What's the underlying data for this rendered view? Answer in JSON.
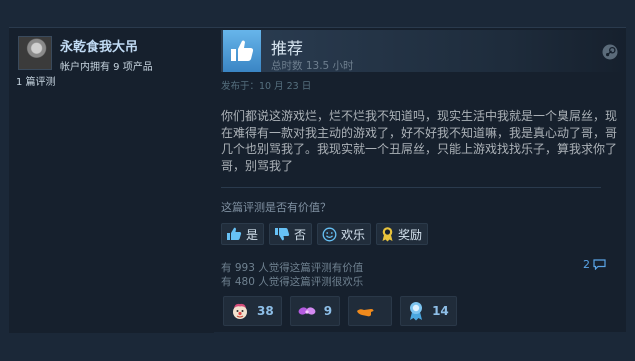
{
  "reviewer": {
    "name": "永乾食我大吊",
    "products_owned": "帐户内拥有 9 项产品",
    "review_count": "1 篇评测"
  },
  "review": {
    "verdict": "推荐",
    "hours": "总时数 13.5 小时",
    "posted": "发布于：10 月 23 日",
    "text": "你们都说这游戏烂，烂不烂我不知道吗，现实生活中我就是一个臭屌丝，现在难得有一款对我主动的游戏了，好不好我不知道嘛，我是真心动了哥，哥几个也别骂我了。我现实就一个丑屌丝，只能上游戏找找乐子，算我求你了哥，别骂我了"
  },
  "helpful": {
    "question": "这篇评测是否有价值？",
    "yes_label": "是",
    "no_label": "否",
    "funny_label": "欢乐",
    "award_label": "奖励",
    "found_helpful": "有 993 人觉得这篇评测有价值",
    "found_funny": "有 480 人觉得这篇评测很欢乐"
  },
  "comments_count": "2",
  "awards": [
    {
      "icon": "clown-face-icon",
      "count": "38"
    },
    {
      "icon": "purple-wings-icon",
      "count": "9"
    },
    {
      "icon": "orange-hand-icon",
      "count": ""
    },
    {
      "icon": "ribbon-medal-icon",
      "count": "14"
    }
  ],
  "colors": {
    "page_bg": "#1b2838",
    "card_bg": "#16202d",
    "thumb_blue": "#67b5ea",
    "link_blue": "#5aa4e6"
  }
}
